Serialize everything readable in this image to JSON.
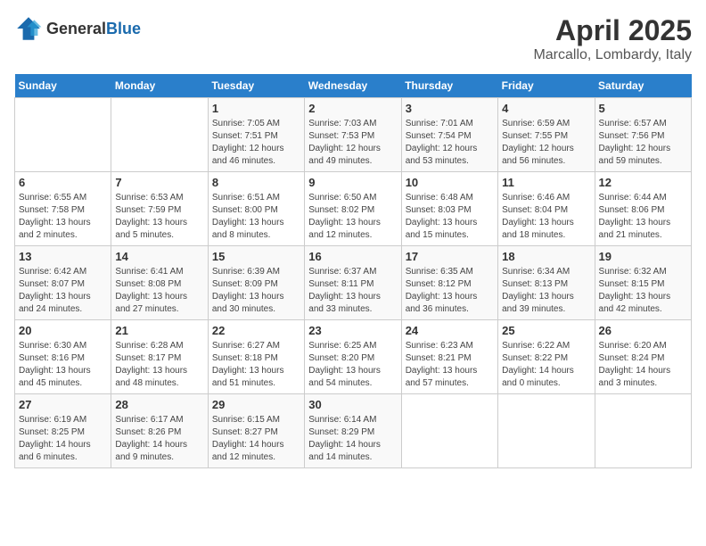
{
  "logo": {
    "general": "General",
    "blue": "Blue"
  },
  "header": {
    "title": "April 2025",
    "subtitle": "Marcallo, Lombardy, Italy"
  },
  "weekdays": [
    "Sunday",
    "Monday",
    "Tuesday",
    "Wednesday",
    "Thursday",
    "Friday",
    "Saturday"
  ],
  "weeks": [
    [
      {
        "day": "",
        "detail": ""
      },
      {
        "day": "",
        "detail": ""
      },
      {
        "day": "1",
        "detail": "Sunrise: 7:05 AM\nSunset: 7:51 PM\nDaylight: 12 hours and 46 minutes."
      },
      {
        "day": "2",
        "detail": "Sunrise: 7:03 AM\nSunset: 7:53 PM\nDaylight: 12 hours and 49 minutes."
      },
      {
        "day": "3",
        "detail": "Sunrise: 7:01 AM\nSunset: 7:54 PM\nDaylight: 12 hours and 53 minutes."
      },
      {
        "day": "4",
        "detail": "Sunrise: 6:59 AM\nSunset: 7:55 PM\nDaylight: 12 hours and 56 minutes."
      },
      {
        "day": "5",
        "detail": "Sunrise: 6:57 AM\nSunset: 7:56 PM\nDaylight: 12 hours and 59 minutes."
      }
    ],
    [
      {
        "day": "6",
        "detail": "Sunrise: 6:55 AM\nSunset: 7:58 PM\nDaylight: 13 hours and 2 minutes."
      },
      {
        "day": "7",
        "detail": "Sunrise: 6:53 AM\nSunset: 7:59 PM\nDaylight: 13 hours and 5 minutes."
      },
      {
        "day": "8",
        "detail": "Sunrise: 6:51 AM\nSunset: 8:00 PM\nDaylight: 13 hours and 8 minutes."
      },
      {
        "day": "9",
        "detail": "Sunrise: 6:50 AM\nSunset: 8:02 PM\nDaylight: 13 hours and 12 minutes."
      },
      {
        "day": "10",
        "detail": "Sunrise: 6:48 AM\nSunset: 8:03 PM\nDaylight: 13 hours and 15 minutes."
      },
      {
        "day": "11",
        "detail": "Sunrise: 6:46 AM\nSunset: 8:04 PM\nDaylight: 13 hours and 18 minutes."
      },
      {
        "day": "12",
        "detail": "Sunrise: 6:44 AM\nSunset: 8:06 PM\nDaylight: 13 hours and 21 minutes."
      }
    ],
    [
      {
        "day": "13",
        "detail": "Sunrise: 6:42 AM\nSunset: 8:07 PM\nDaylight: 13 hours and 24 minutes."
      },
      {
        "day": "14",
        "detail": "Sunrise: 6:41 AM\nSunset: 8:08 PM\nDaylight: 13 hours and 27 minutes."
      },
      {
        "day": "15",
        "detail": "Sunrise: 6:39 AM\nSunset: 8:09 PM\nDaylight: 13 hours and 30 minutes."
      },
      {
        "day": "16",
        "detail": "Sunrise: 6:37 AM\nSunset: 8:11 PM\nDaylight: 13 hours and 33 minutes."
      },
      {
        "day": "17",
        "detail": "Sunrise: 6:35 AM\nSunset: 8:12 PM\nDaylight: 13 hours and 36 minutes."
      },
      {
        "day": "18",
        "detail": "Sunrise: 6:34 AM\nSunset: 8:13 PM\nDaylight: 13 hours and 39 minutes."
      },
      {
        "day": "19",
        "detail": "Sunrise: 6:32 AM\nSunset: 8:15 PM\nDaylight: 13 hours and 42 minutes."
      }
    ],
    [
      {
        "day": "20",
        "detail": "Sunrise: 6:30 AM\nSunset: 8:16 PM\nDaylight: 13 hours and 45 minutes."
      },
      {
        "day": "21",
        "detail": "Sunrise: 6:28 AM\nSunset: 8:17 PM\nDaylight: 13 hours and 48 minutes."
      },
      {
        "day": "22",
        "detail": "Sunrise: 6:27 AM\nSunset: 8:18 PM\nDaylight: 13 hours and 51 minutes."
      },
      {
        "day": "23",
        "detail": "Sunrise: 6:25 AM\nSunset: 8:20 PM\nDaylight: 13 hours and 54 minutes."
      },
      {
        "day": "24",
        "detail": "Sunrise: 6:23 AM\nSunset: 8:21 PM\nDaylight: 13 hours and 57 minutes."
      },
      {
        "day": "25",
        "detail": "Sunrise: 6:22 AM\nSunset: 8:22 PM\nDaylight: 14 hours and 0 minutes."
      },
      {
        "day": "26",
        "detail": "Sunrise: 6:20 AM\nSunset: 8:24 PM\nDaylight: 14 hours and 3 minutes."
      }
    ],
    [
      {
        "day": "27",
        "detail": "Sunrise: 6:19 AM\nSunset: 8:25 PM\nDaylight: 14 hours and 6 minutes."
      },
      {
        "day": "28",
        "detail": "Sunrise: 6:17 AM\nSunset: 8:26 PM\nDaylight: 14 hours and 9 minutes."
      },
      {
        "day": "29",
        "detail": "Sunrise: 6:15 AM\nSunset: 8:27 PM\nDaylight: 14 hours and 12 minutes."
      },
      {
        "day": "30",
        "detail": "Sunrise: 6:14 AM\nSunset: 8:29 PM\nDaylight: 14 hours and 14 minutes."
      },
      {
        "day": "",
        "detail": ""
      },
      {
        "day": "",
        "detail": ""
      },
      {
        "day": "",
        "detail": ""
      }
    ]
  ]
}
